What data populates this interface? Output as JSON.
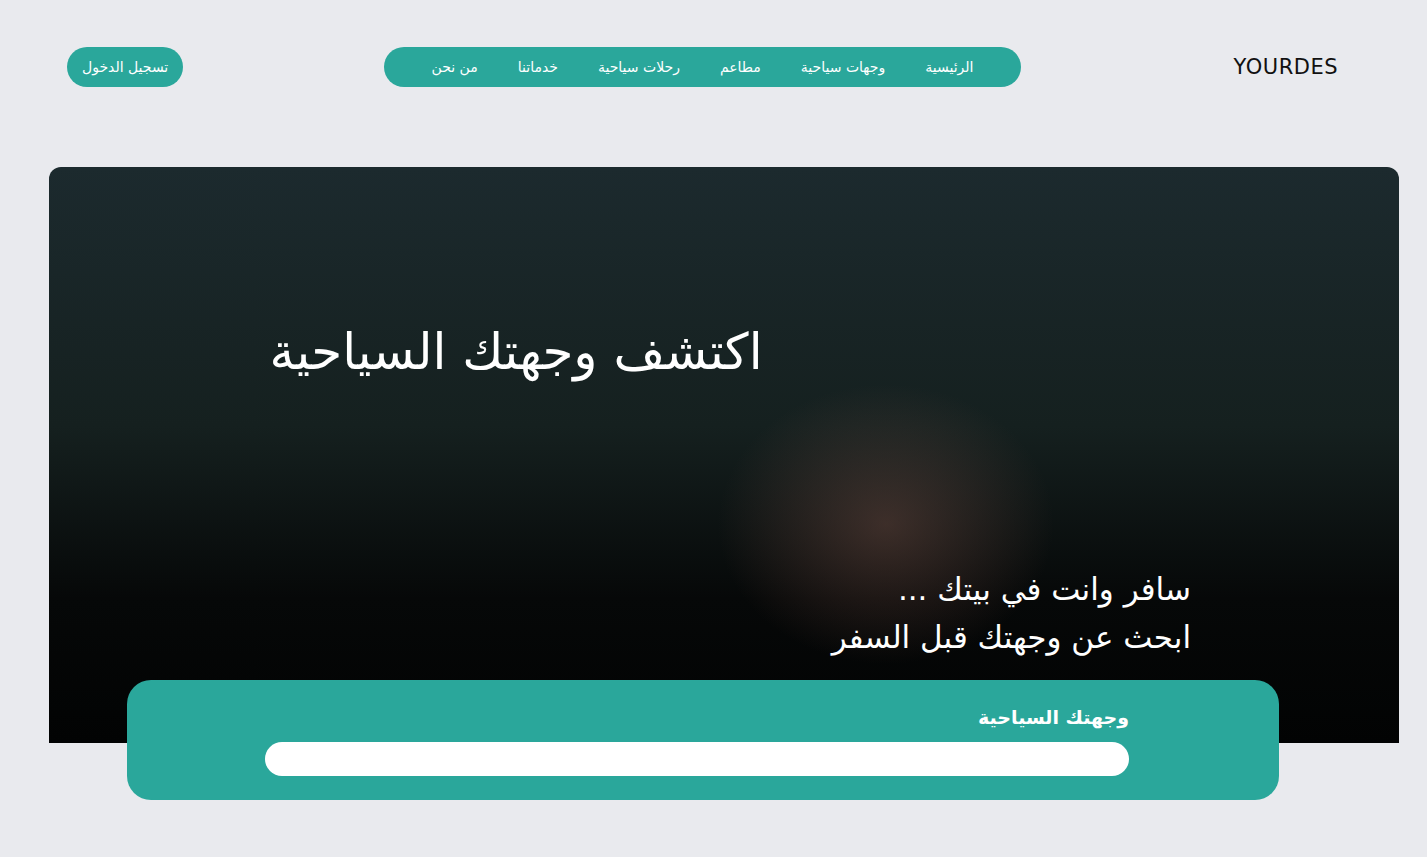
{
  "brand": "YOURDES",
  "nav": [
    {
      "label": "الرئيسية",
      "selected": false
    },
    {
      "label": "وجهات سياحية",
      "selected": false
    },
    {
      "label": "مطاعم",
      "selected": false
    },
    {
      "label": "رحلات سياحية",
      "selected": false
    },
    {
      "label": "خدماتنا",
      "selected": false
    },
    {
      "label": "من نحن",
      "selected": false
    }
  ],
  "login": "تسجيل الدخول",
  "hero": {
    "title": "اكتشف وجهتك السياحية",
    "subtitle": [
      "سافر وانت في بيتك ...",
      "ابحث عن وجهتك قبل السفر"
    ]
  },
  "search": {
    "label": "وجهتك السياحية",
    "value": ""
  }
}
